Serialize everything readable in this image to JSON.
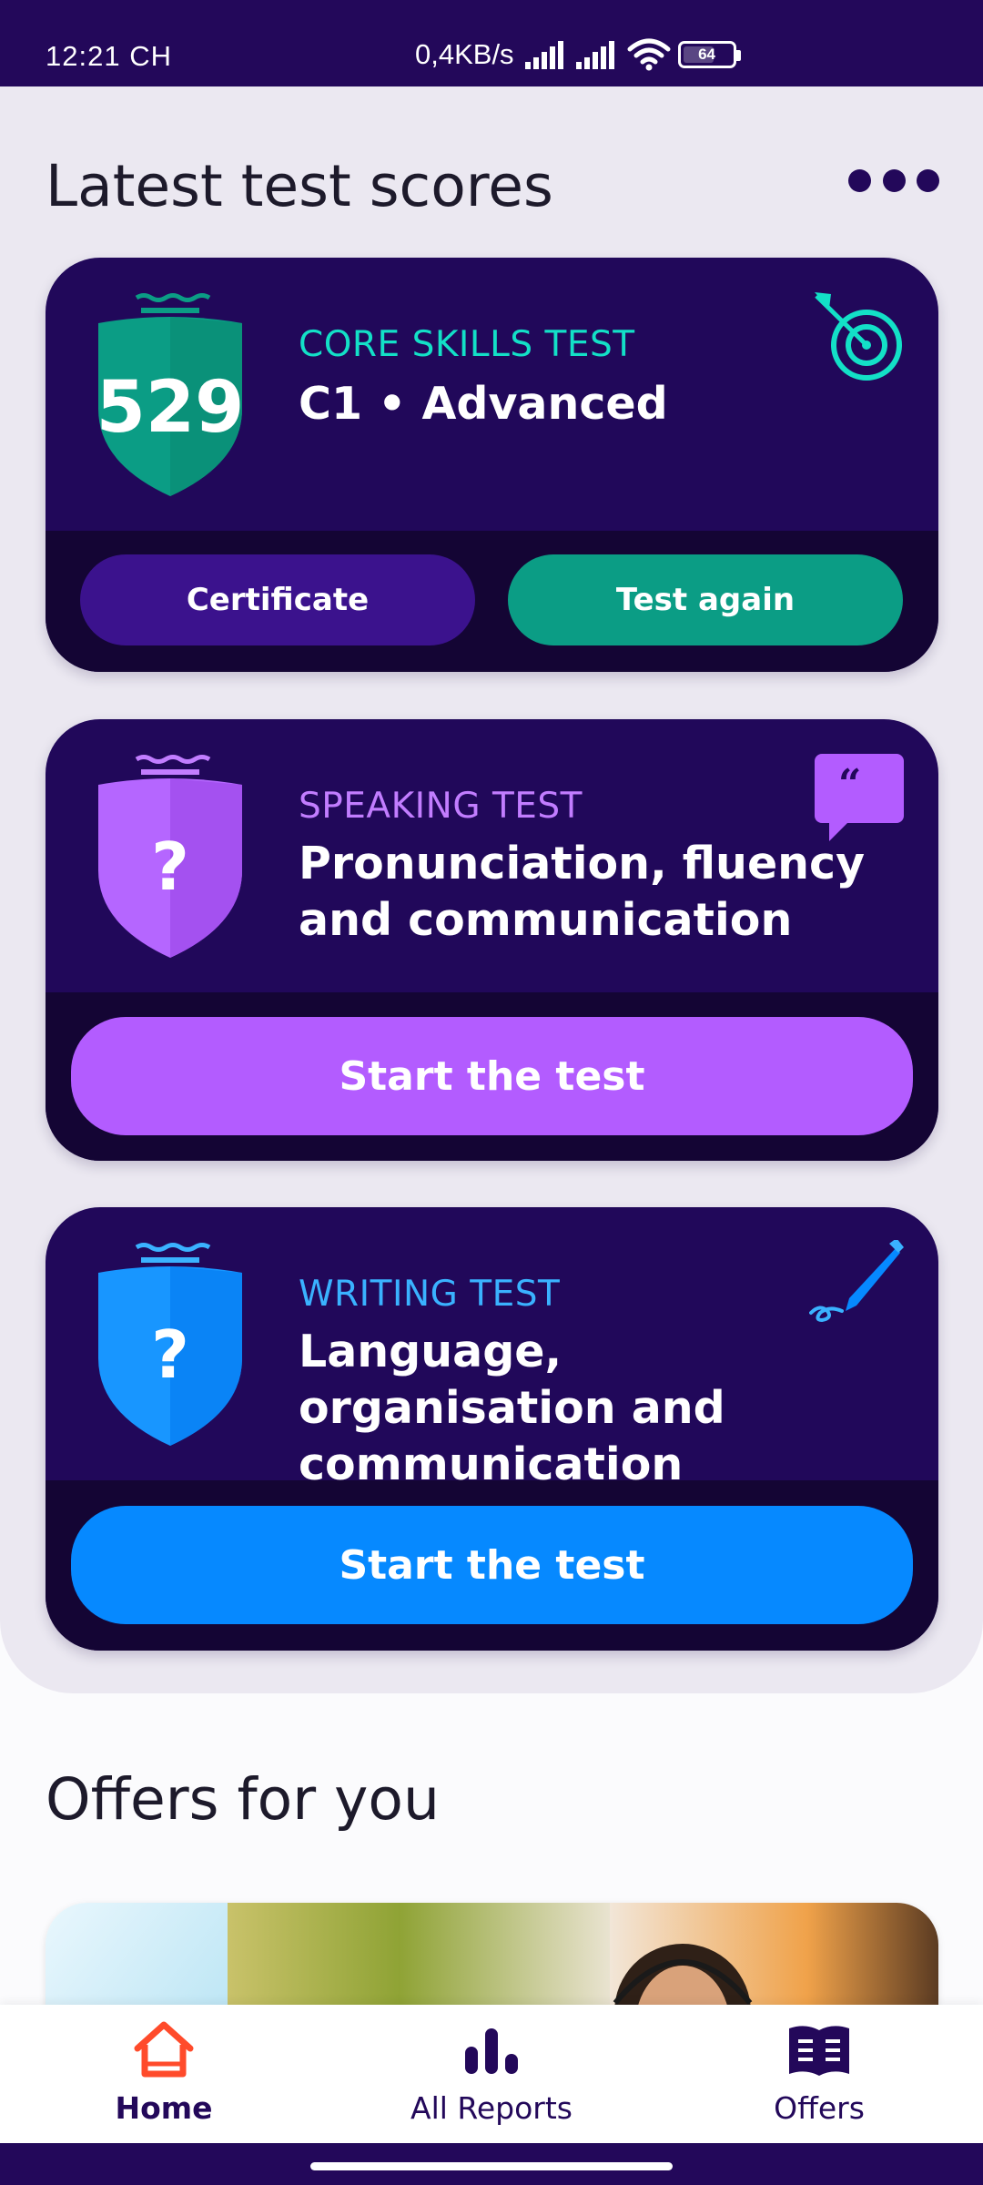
{
  "status_bar": {
    "time": "12:21 CH",
    "network_speed": "0,4KB/s",
    "battery_level": "64"
  },
  "scores_section": {
    "title": "Latest test scores",
    "more_icon": "more-horizontal-icon"
  },
  "cards": [
    {
      "kind": "CORE SKILLS TEST",
      "description": "C1 • Advanced",
      "score": "529",
      "icon": "target-icon",
      "accent": "#13e0c7",
      "shield_color": "#0b9d85",
      "buttons": {
        "certificate": "Certificate",
        "test_again": "Test again"
      }
    },
    {
      "kind": "SPEAKING TEST",
      "description": "Pronunciation, fluency and communication",
      "score": "?",
      "icon": "speech-bubble-icon",
      "accent": "#c27dff",
      "shield_color": "#a451f0",
      "button": "Start the test",
      "button_color": "#b35cff"
    },
    {
      "kind": "WRITING TEST",
      "description": "Language, organisation and communication",
      "score": "?",
      "icon": "pen-icon",
      "accent": "#3ab2ff",
      "shield_color": "#0a84f6",
      "button": "Start the test",
      "button_color": "#0689ff"
    }
  ],
  "offers": {
    "title": "Offers for you"
  },
  "bottom_nav": [
    {
      "label": "Home",
      "icon": "home-icon",
      "active": true
    },
    {
      "label": "All Reports",
      "icon": "bar-chart-icon",
      "active": false
    },
    {
      "label": "Offers",
      "icon": "book-icon",
      "active": false
    }
  ]
}
